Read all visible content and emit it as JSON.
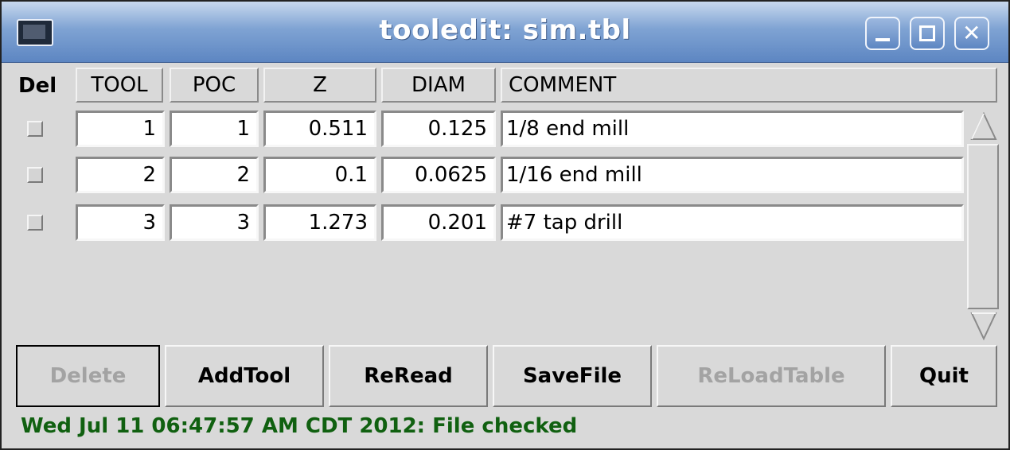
{
  "window": {
    "title": "tooledit: sim.tbl",
    "icons": {
      "menu": "monitor-icon",
      "minimize": "minimize-icon",
      "maximize": "maximize-icon",
      "close": "close-icon"
    }
  },
  "table": {
    "columns": {
      "del": "Del",
      "tool": "TOOL",
      "poc": "POC",
      "z": "Z",
      "diam": "DIAM",
      "comment": "COMMENT"
    },
    "rows": [
      {
        "tool": "1",
        "poc": "1",
        "z": "0.511",
        "diam": "0.125",
        "comment": "1/8 end mill"
      },
      {
        "tool": "2",
        "poc": "2",
        "z": "0.1",
        "diam": "0.0625",
        "comment": "1/16 end mill"
      },
      {
        "tool": "3",
        "poc": "3",
        "z": "1.273",
        "diam": "0.201",
        "comment": "#7 tap drill"
      }
    ]
  },
  "buttons": {
    "delete": "Delete",
    "add_tool": "AddTool",
    "reread": "ReRead",
    "save_file": "SaveFile",
    "reload_table": "ReLoadTable",
    "quit": "Quit"
  },
  "status": "Wed Jul 11 06:47:57 AM CDT 2012: File checked",
  "colors": {
    "title_bar": "#7fa3d3",
    "status_text": "#106010",
    "disabled_text": "#a3a3a3"
  }
}
